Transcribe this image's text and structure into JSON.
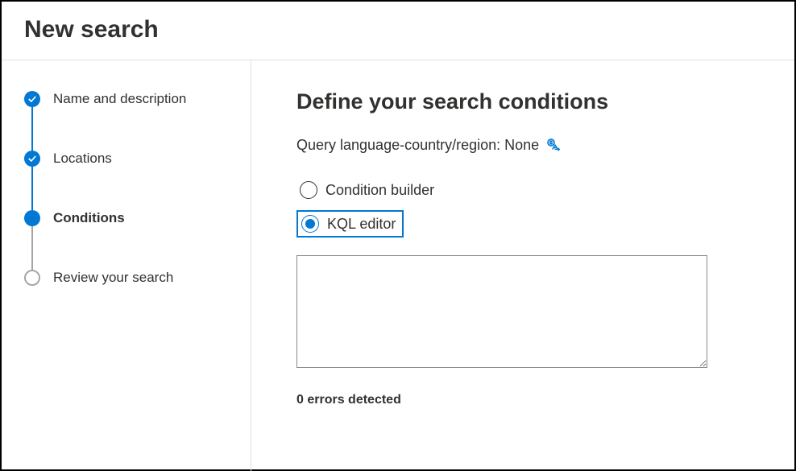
{
  "header": {
    "title": "New search"
  },
  "sidebar": {
    "steps": [
      {
        "label": "Name and description",
        "state": "done"
      },
      {
        "label": "Locations",
        "state": "done"
      },
      {
        "label": "Conditions",
        "state": "current"
      },
      {
        "label": "Review your search",
        "state": "pending"
      }
    ]
  },
  "main": {
    "heading": "Define your search conditions",
    "query_language_label": "Query language-country/region: None",
    "radio_options": {
      "condition_builder": "Condition builder",
      "kql_editor": "KQL editor"
    },
    "selected_option": "kql_editor",
    "kql_value": "",
    "errors_text": "0 errors detected"
  }
}
